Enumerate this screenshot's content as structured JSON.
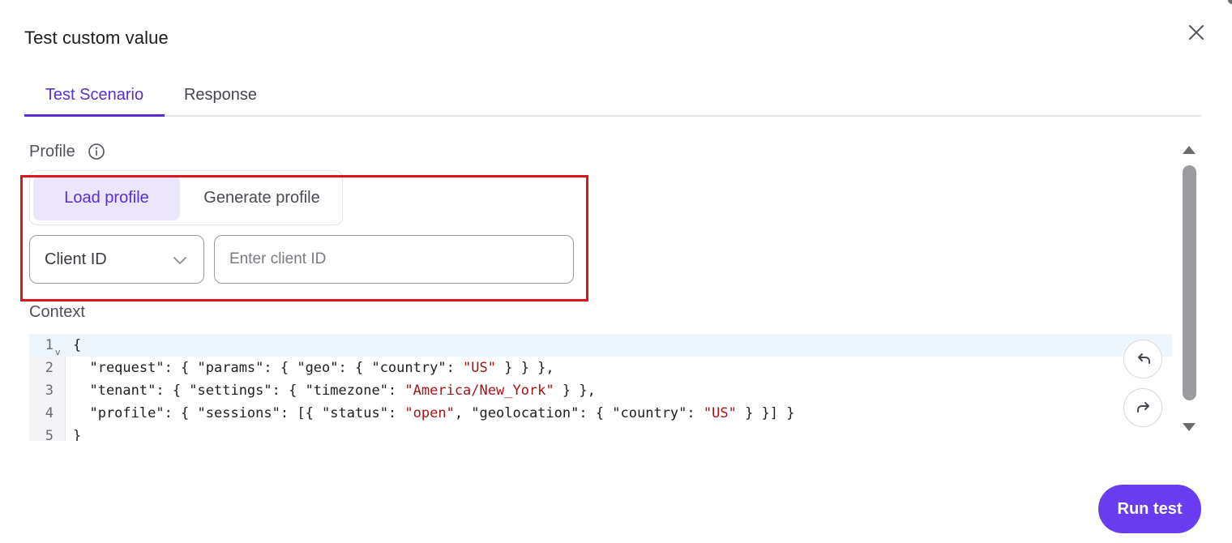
{
  "dialog": {
    "title": "Test custom value",
    "close_icon": "close-icon"
  },
  "tabs": [
    {
      "label": "Test Scenario",
      "active": true
    },
    {
      "label": "Response",
      "active": false
    }
  ],
  "profile": {
    "label": "Profile",
    "info_icon": "info-icon",
    "segments": [
      {
        "label": "Load profile",
        "selected": true
      },
      {
        "label": "Generate profile",
        "selected": false
      }
    ],
    "id_type": {
      "value": "Client ID",
      "icon": "chevron-down-icon"
    },
    "client_id_input": {
      "value": "",
      "placeholder": "Enter client ID"
    }
  },
  "context": {
    "label": "Context",
    "lines": [
      {
        "n": "1",
        "text": "{"
      },
      {
        "n": "2",
        "text": "  \"request\": { \"params\": { \"geo\": { \"country\": \"US\" } } },"
      },
      {
        "n": "3",
        "text": "  \"tenant\": { \"settings\": { \"timezone\": \"America/New_York\" } },"
      },
      {
        "n": "4",
        "text": "  \"profile\": { \"sessions\": [{ \"status\": \"open\", \"geolocation\": { \"country\": \"US\" } }] }"
      },
      {
        "n": "5",
        "text": "}"
      }
    ],
    "undo_icon": "undo-icon",
    "redo_icon": "redo-icon"
  },
  "footer": {
    "run_label": "Run test"
  },
  "colors": {
    "accent": "#6a3cf0",
    "active_tab": "#5a2ed4",
    "selected_segment_bg": "#ebe6fc",
    "highlight_border": "#e0141b",
    "json_string": "#a31515"
  }
}
